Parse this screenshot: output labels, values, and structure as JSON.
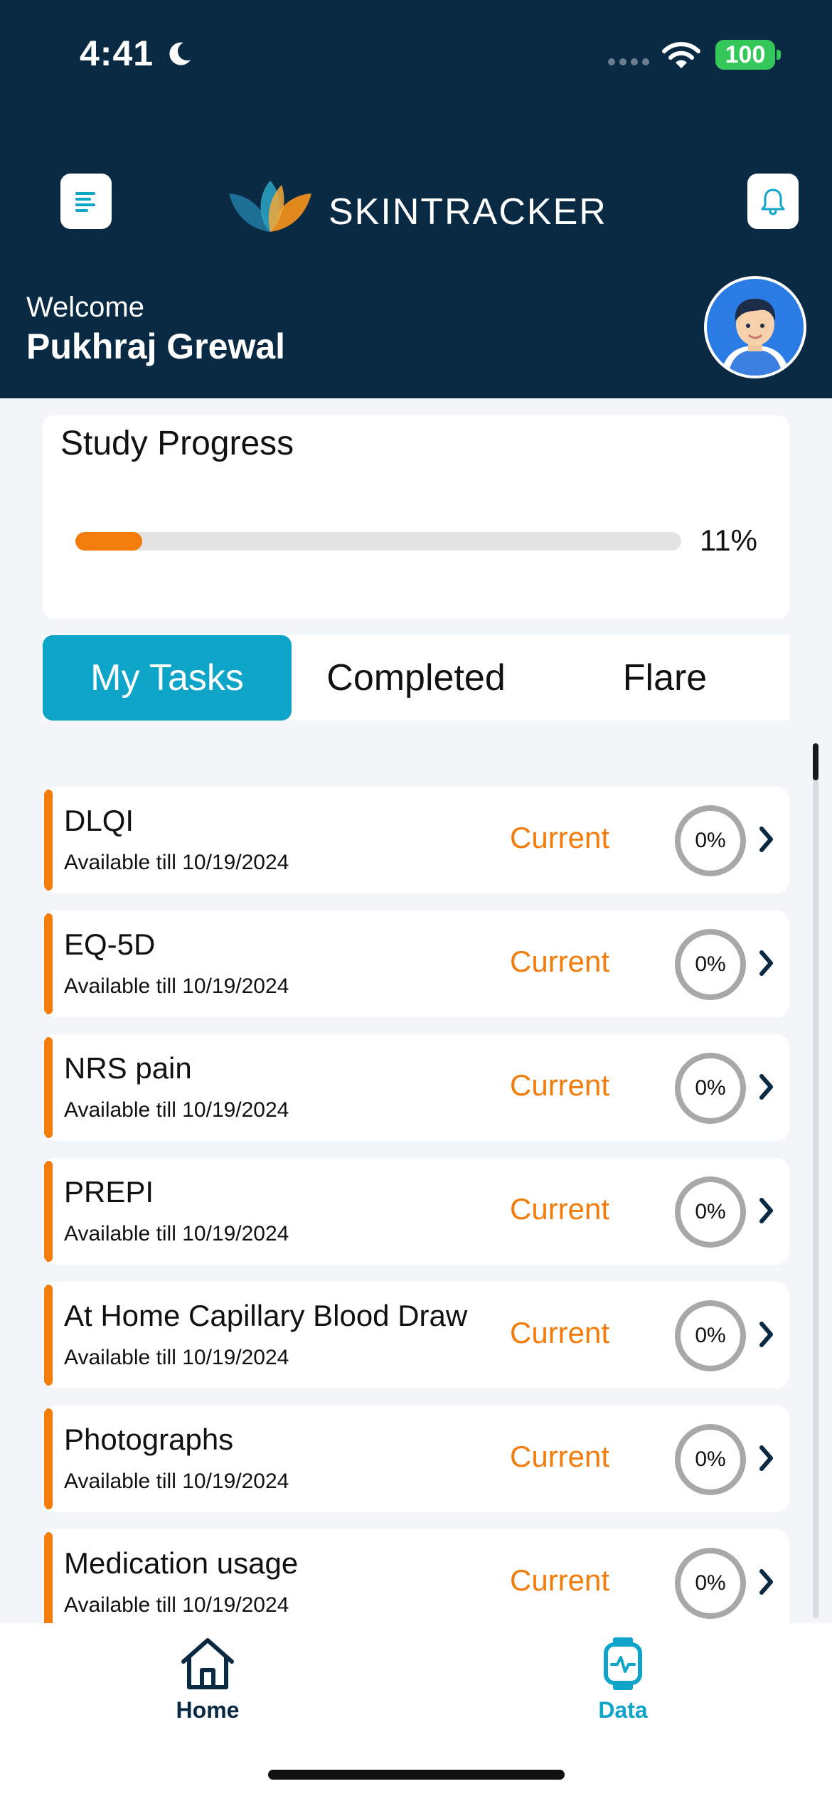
{
  "status_bar": {
    "time": "4:41",
    "battery": "100"
  },
  "header": {
    "app_name": "SKINTRACKER",
    "welcome": "Welcome",
    "user_name": "Pukhraj Grewal"
  },
  "progress": {
    "title": "Study Progress",
    "label": "11%",
    "value": 0.11
  },
  "tabs": [
    {
      "label": "My Tasks",
      "active": true
    },
    {
      "label": "Completed",
      "active": false
    },
    {
      "label": "Flare",
      "active": false
    }
  ],
  "tasks": [
    {
      "name": "DLQI",
      "available": "Available till 10/19/2024",
      "status": "Current",
      "progress": "0%"
    },
    {
      "name": "EQ-5D",
      "available": "Available till 10/19/2024",
      "status": "Current",
      "progress": "0%"
    },
    {
      "name": "NRS pain",
      "available": "Available till 10/19/2024",
      "status": "Current",
      "progress": "0%"
    },
    {
      "name": "PREPI",
      "available": "Available till 10/19/2024",
      "status": "Current",
      "progress": "0%"
    },
    {
      "name": "At Home Capillary Blood Draw",
      "available": "Available till 10/19/2024",
      "status": "Current",
      "progress": "0%"
    },
    {
      "name": "Photographs",
      "available": "Available till 10/19/2024",
      "status": "Current",
      "progress": "0%"
    },
    {
      "name": "Medication usage",
      "available": "Available till 10/19/2024",
      "status": "Current",
      "progress": "0%"
    }
  ],
  "bottom_nav": {
    "home_label": "Home",
    "data_label": "Data"
  },
  "colors": {
    "header_bg": "#0a2a44",
    "accent_orange": "#f27d0c",
    "accent_teal": "#0ea5c9"
  },
  "icons": {
    "menu": "menu-icon",
    "bell": "bell-icon",
    "home": "home-icon",
    "data": "watch-activity-icon",
    "chevron": "chevron-right-icon"
  }
}
